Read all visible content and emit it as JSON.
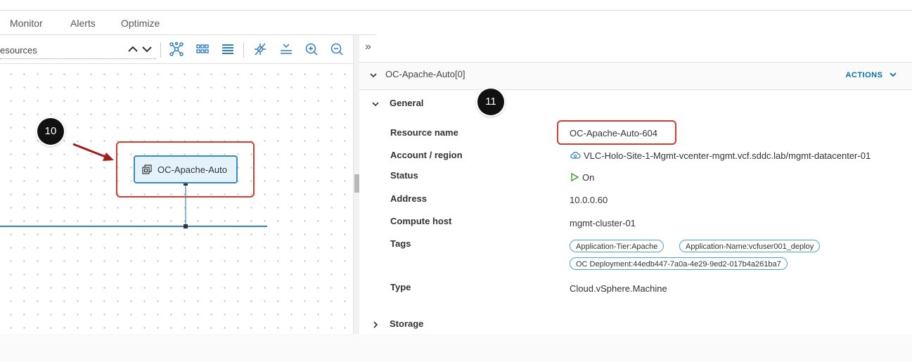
{
  "tabs": [
    {
      "label": "Monitor"
    },
    {
      "label": "Alerts"
    },
    {
      "label": "Optimize"
    }
  ],
  "toolbar": {
    "filter_text": "esources",
    "icons": [
      "chevron-up-icon",
      "chevron-down-icon",
      "topology-icon",
      "grid-view-icon",
      "list-view-icon",
      "hide-links-icon",
      "fit-icon",
      "zoom-in-icon",
      "zoom-out-icon"
    ]
  },
  "canvas": {
    "node_label": "OC-Apache-Auto",
    "callout_10": "10"
  },
  "panel": {
    "collapse_label": "»",
    "title": "OC-Apache-Auto[0]",
    "actions_label": "ACTIONS",
    "callout_11": "11",
    "general_label": "General",
    "storage_label": "Storage",
    "properties": {
      "resource_name": {
        "label": "Resource name",
        "value": "OC-Apache-Auto-604"
      },
      "account_region": {
        "label": "Account / region",
        "value": "VLC-Holo-Site-1-Mgmt-vcenter-mgmt.vcf.sddc.lab/mgmt-datacenter-01"
      },
      "status": {
        "label": "Status",
        "value": "On"
      },
      "address": {
        "label": "Address",
        "value": "10.0.0.60"
      },
      "compute_host": {
        "label": "Compute host",
        "value": "mgmt-cluster-01"
      },
      "tags": {
        "label": "Tags",
        "values": [
          "Application-Tier:Apache",
          "Application-Name:vcfuser001_deploy",
          "OC Deployment:44edb447-7a0a-4e29-9ed2-017b4a261ba7"
        ]
      },
      "type": {
        "label": "Type",
        "value": "Cloud.vSphere.Machine"
      }
    }
  },
  "colors": {
    "callout_red": "#d33c2f",
    "node_border": "#3a8ac4",
    "node_fill": "#e4f2fb",
    "link_blue": "#0072a3",
    "status_green": "#3b9c2e",
    "tag_border": "#49a3d9"
  }
}
